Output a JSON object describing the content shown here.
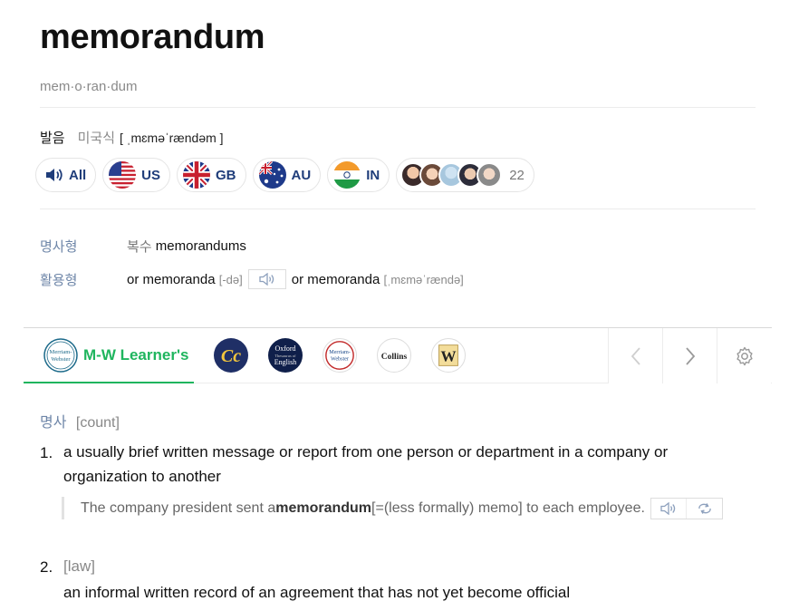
{
  "entry": {
    "headword": "memorandum",
    "syllables": "mem·o·ran·dum"
  },
  "pronunciation": {
    "label": "발음",
    "dialect": "미국식",
    "ipa": "[ ˌmɛməˈrændəm ]"
  },
  "accents": [
    {
      "label": "All",
      "icon": "speaker-icon"
    },
    {
      "label": "US",
      "icon": "us-flag-icon"
    },
    {
      "label": "GB",
      "icon": "gb-flag-icon"
    },
    {
      "label": "AU",
      "icon": "au-flag-icon"
    },
    {
      "label": "IN",
      "icon": "in-flag-icon"
    }
  ],
  "user_recordings": {
    "count": "22"
  },
  "forms": {
    "noun_label": "명사형",
    "noun_plural_label": "복수",
    "noun_plural_value": "memorandums",
    "inflection_label": "활용형",
    "alt1_prefix": "or",
    "alt1_word": "memoranda",
    "alt1_pron": "[-də]",
    "alt2_prefix": "or",
    "alt2_word": "memoranda",
    "alt2_pron": "[ˌmɛməˈrændə]"
  },
  "dictionaries": {
    "active_name": "M-W Learner's",
    "active_logo": "Merriam Webster",
    "others": [
      {
        "name": "cobuild-icon",
        "text": "Cc"
      },
      {
        "name": "oxford-icon",
        "text": "Oxford English"
      },
      {
        "name": "merriam-webster-icon",
        "text": "Merriam Webster"
      },
      {
        "name": "collins-icon",
        "text": "Collins"
      },
      {
        "name": "wordnet-icon",
        "text": "W"
      }
    ]
  },
  "definition": {
    "pos": "명사",
    "countability": "[count]",
    "senses": [
      {
        "num": "1.",
        "text": "a usually brief written message or report from one person or department in a company or organization to another",
        "example_pre": "The company president sent a ",
        "example_bold": "memorandum",
        "example_post": " [=(less formally) memo] to each employee."
      },
      {
        "num": "2.",
        "label": "[law]",
        "text": "an informal written record of an agreement that has not yet become official"
      }
    ]
  },
  "colors": {
    "accent_green": "#1fb55e",
    "label_blue": "#6e86a8",
    "pill_text": "#1f3d7a"
  }
}
